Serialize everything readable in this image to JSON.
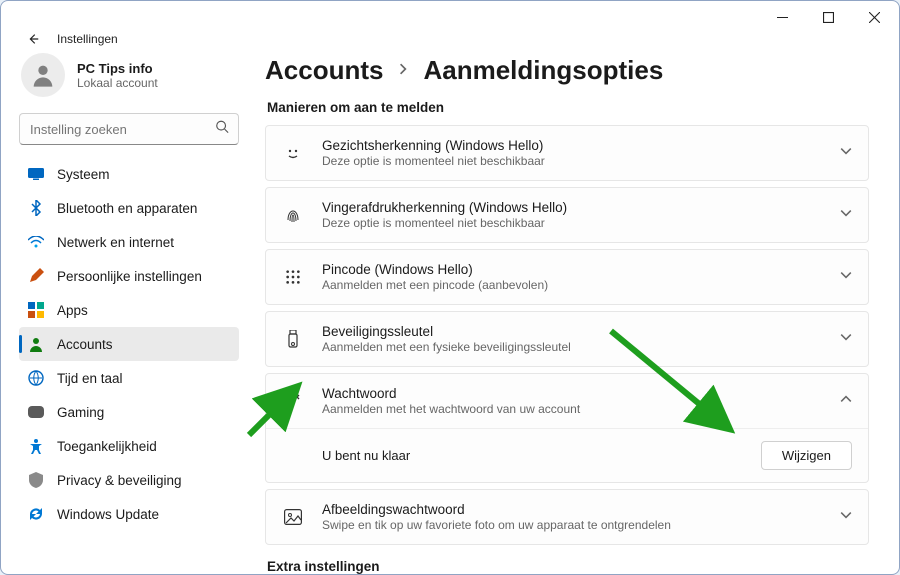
{
  "window": {
    "app_title": "Instellingen"
  },
  "profile": {
    "name": "PC Tips info",
    "subtitle": "Lokaal account"
  },
  "search": {
    "placeholder": "Instelling zoeken"
  },
  "sidebar": {
    "items": [
      {
        "label": "Systeem"
      },
      {
        "label": "Bluetooth en apparaten"
      },
      {
        "label": "Netwerk en internet"
      },
      {
        "label": "Persoonlijke instellingen"
      },
      {
        "label": "Apps"
      },
      {
        "label": "Accounts"
      },
      {
        "label": "Tijd en taal"
      },
      {
        "label": "Gaming"
      },
      {
        "label": "Toegankelijkheid"
      },
      {
        "label": "Privacy & beveiliging"
      },
      {
        "label": "Windows Update"
      }
    ]
  },
  "breadcrumb": {
    "parent": "Accounts",
    "current": "Aanmeldingsopties"
  },
  "section": {
    "title": "Manieren om aan te melden"
  },
  "options": {
    "face": {
      "title": "Gezichtsherkenning (Windows Hello)",
      "sub": "Deze optie is momenteel niet beschikbaar"
    },
    "finger": {
      "title": "Vingerafdrukherkenning (Windows Hello)",
      "sub": "Deze optie is momenteel niet beschikbaar"
    },
    "pin": {
      "title": "Pincode (Windows Hello)",
      "sub": "Aanmelden met een pincode (aanbevolen)"
    },
    "key": {
      "title": "Beveiligingssleutel",
      "sub": "Aanmelden met een fysieke beveiligingssleutel"
    },
    "password": {
      "title": "Wachtwoord",
      "sub": "Aanmelden met het wachtwoord van uw account",
      "ready_text": "U bent nu klaar",
      "change_btn": "Wijzigen"
    },
    "picture": {
      "title": "Afbeeldingswachtwoord",
      "sub": "Swipe en tik op uw favoriete foto om uw apparaat te ontgrendelen"
    }
  },
  "footer": {
    "title": "Extra instellingen"
  }
}
